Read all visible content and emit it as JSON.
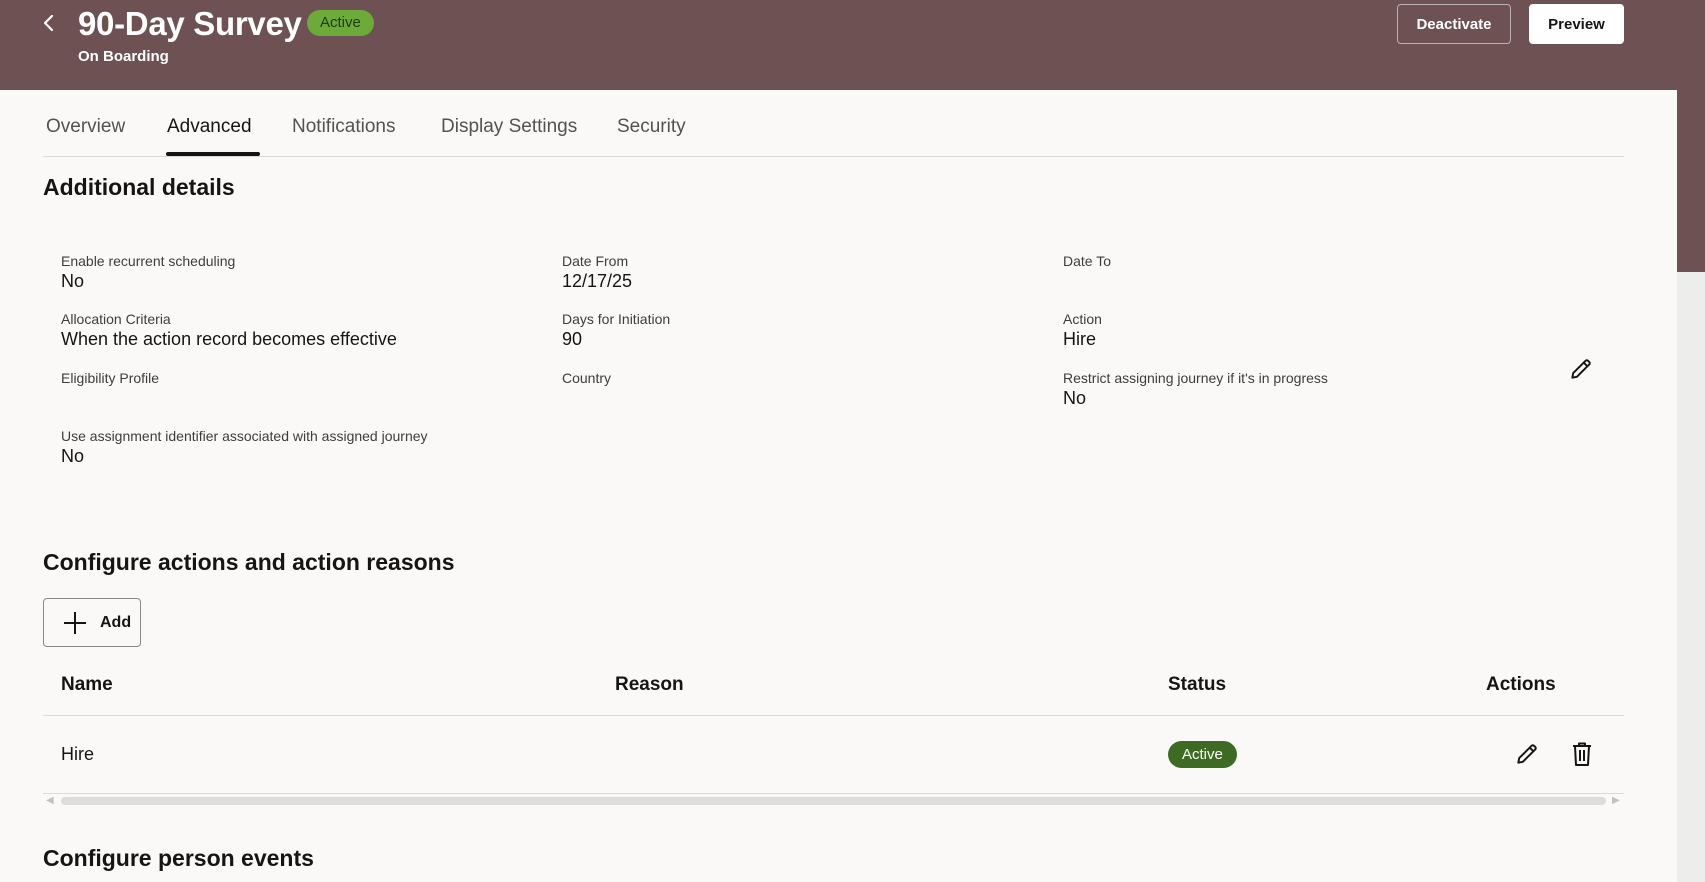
{
  "colors": {
    "header_bg": "#6e5253",
    "page_bg": "#fbf9f8",
    "active_badge_bg": "#6cab3a",
    "status_badge_bg": "#3d6b23"
  },
  "header": {
    "back_icon": "chevron-left-icon",
    "title": "90-Day Survey",
    "badge": "Active",
    "subtitle": "On Boarding",
    "deactivate_label": "Deactivate",
    "preview_label": "Preview"
  },
  "tabs": [
    {
      "label": "Overview",
      "active": false
    },
    {
      "label": "Advanced",
      "active": true
    },
    {
      "label": "Notifications",
      "active": false
    },
    {
      "label": "Display Settings",
      "active": false
    },
    {
      "label": "Security",
      "active": false
    }
  ],
  "additional_details": {
    "title": "Additional details",
    "edit_icon": "pencil-icon",
    "fields": [
      {
        "label": "Enable recurrent scheduling",
        "value": "No"
      },
      {
        "label": "Date From",
        "value": "12/17/25"
      },
      {
        "label": "Date To",
        "value": ""
      },
      {
        "label": "Allocation Criteria",
        "value": "When the action record becomes effective"
      },
      {
        "label": "Days for Initiation",
        "value": "90"
      },
      {
        "label": "Action",
        "value": "Hire"
      },
      {
        "label": "Eligibility Profile",
        "value": ""
      },
      {
        "label": "Country",
        "value": ""
      },
      {
        "label": "Restrict assigning journey if it's in progress",
        "value": "No"
      },
      {
        "label": "Use assignment identifier associated with assigned journey",
        "value": "No"
      }
    ]
  },
  "configure_actions": {
    "title": "Configure actions and action reasons",
    "add_label": "Add",
    "add_icon": "plus-icon",
    "columns": [
      "Name",
      "Reason",
      "Status",
      "Actions"
    ],
    "rows": [
      {
        "name": "Hire",
        "reason": "",
        "status": "Active",
        "action_icons": [
          "pencil-icon",
          "trash-icon"
        ]
      }
    ]
  },
  "configure_person_events": {
    "title": "Configure person events"
  }
}
